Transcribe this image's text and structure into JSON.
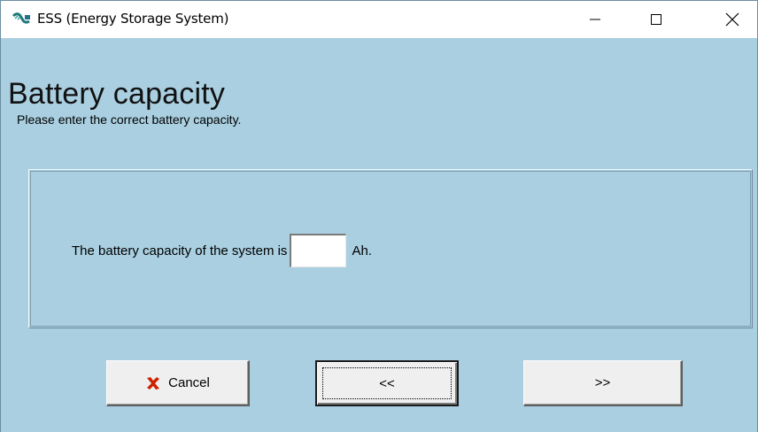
{
  "window": {
    "title": "ESS (Energy Storage System)",
    "controls": [
      "minimize",
      "maximize",
      "close"
    ]
  },
  "page": {
    "heading": "Battery capacity",
    "subheading": "Please enter the correct battery capacity."
  },
  "form": {
    "prefix": "The battery capacity of the system is",
    "capacity_value": "",
    "unit": "Ah."
  },
  "buttons": {
    "cancel": "Cancel",
    "back": "<<",
    "next": ">>"
  },
  "colors": {
    "background": "#a9cfe0",
    "cancel_icon": "#cc2200"
  }
}
